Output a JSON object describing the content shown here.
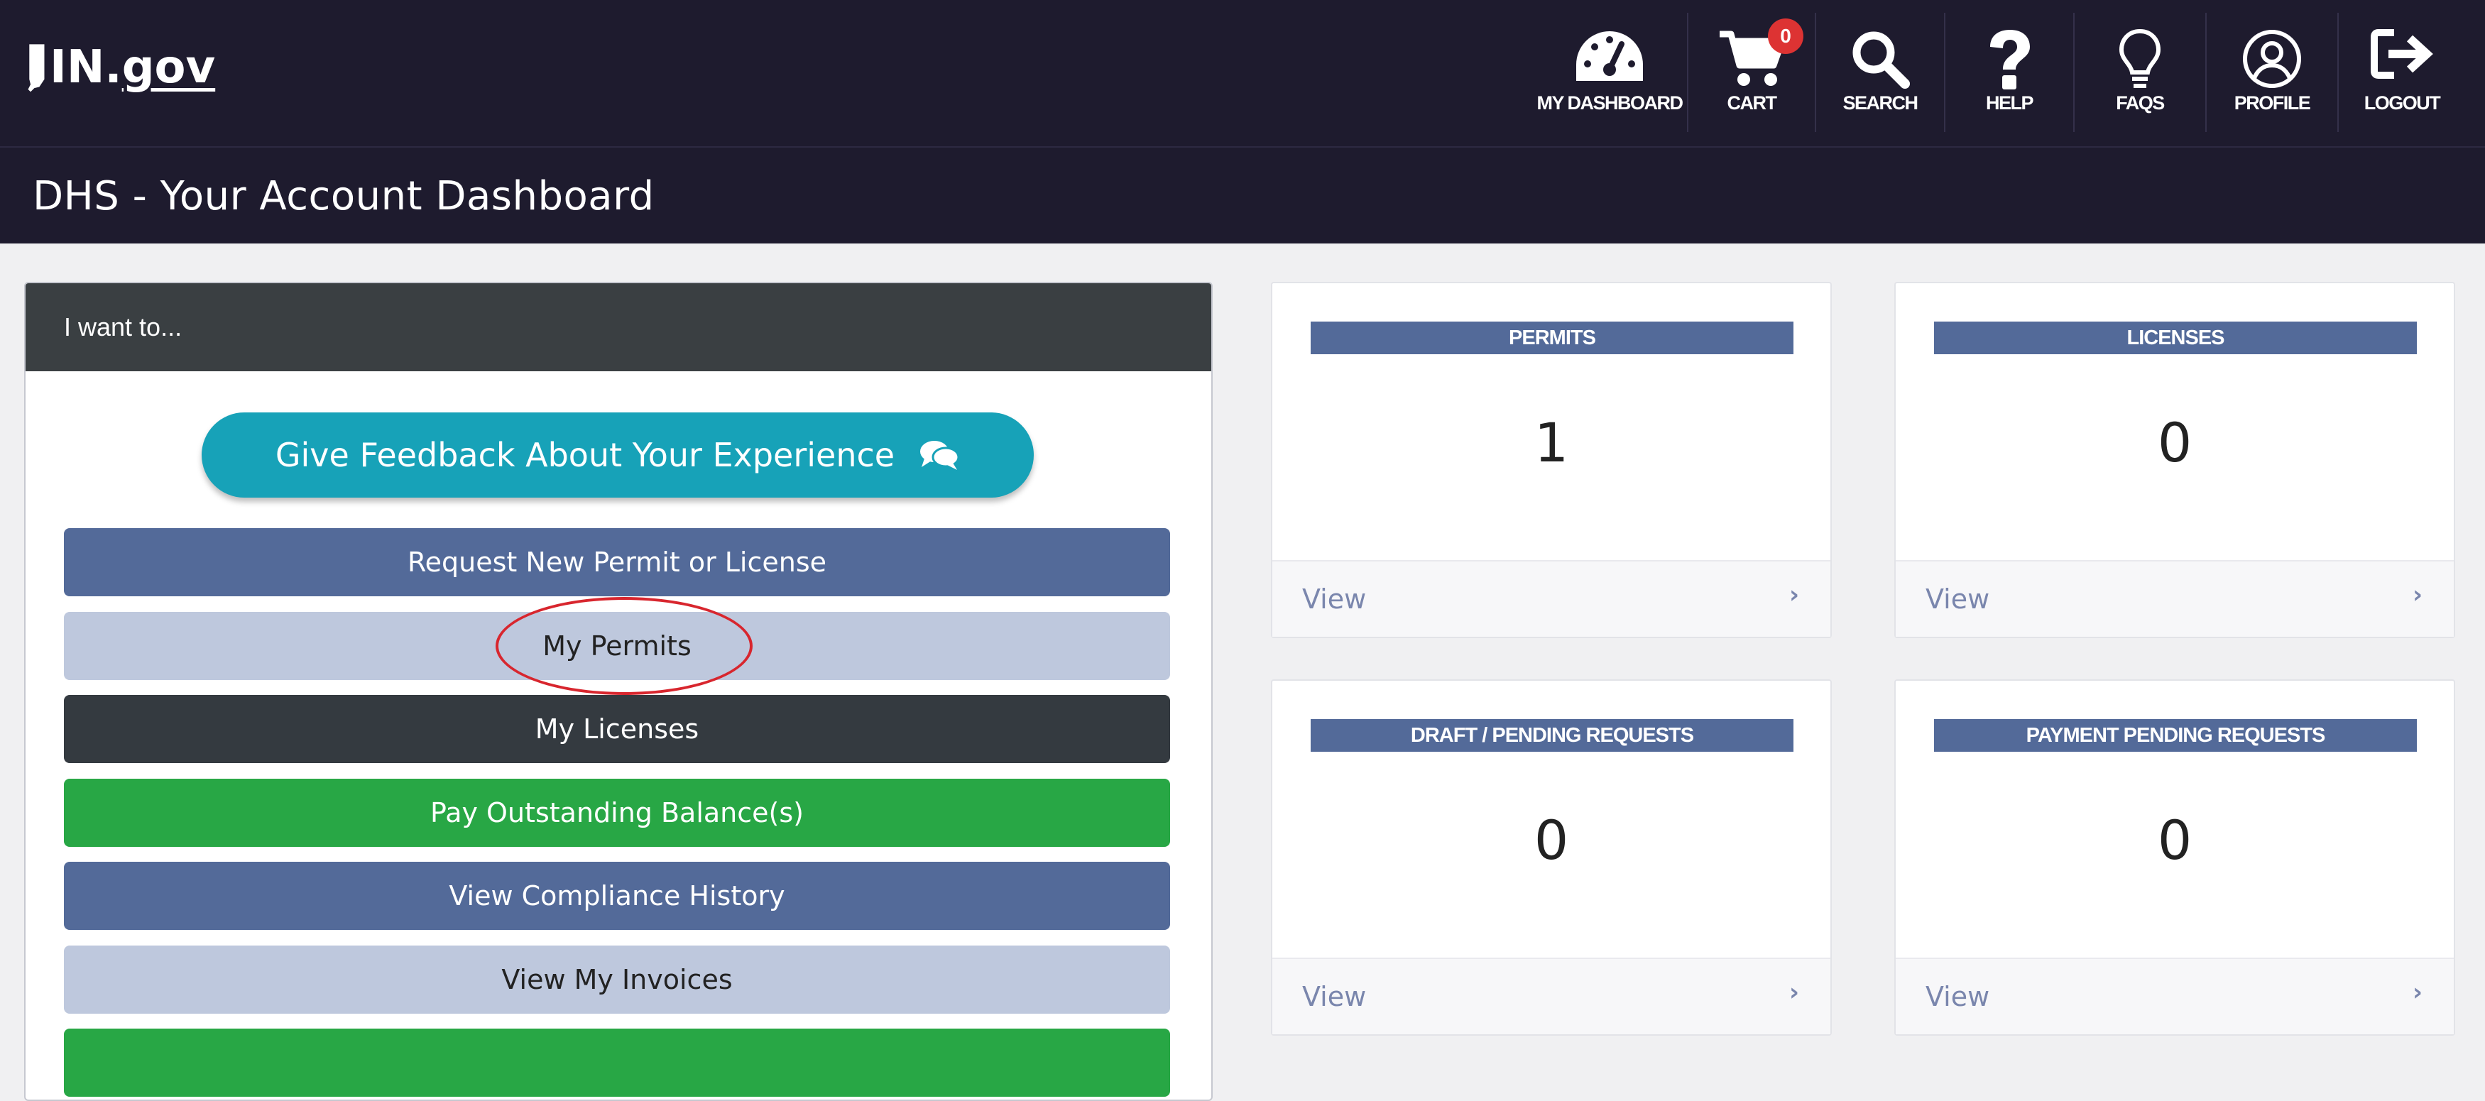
{
  "brand": {
    "logo_prefix": "IN.",
    "logo_suffix": "gov"
  },
  "nav": {
    "items": [
      {
        "label": "MY DASHBOARD",
        "icon": "dashboard-gauge-icon"
      },
      {
        "label": "CART",
        "icon": "cart-icon",
        "badge": "0"
      },
      {
        "label": "SEARCH",
        "icon": "search-icon"
      },
      {
        "label": "HELP",
        "icon": "question-icon"
      },
      {
        "label": "FAQS",
        "icon": "lightbulb-icon"
      },
      {
        "label": "PROFILE",
        "icon": "user-circle-icon"
      },
      {
        "label": "LOGOUT",
        "icon": "logout-icon"
      }
    ]
  },
  "page": {
    "title": "DHS - Your Account Dashboard"
  },
  "panel": {
    "heading": "I want to...",
    "feedback_label": "Give Feedback About Your Experience",
    "actions": [
      {
        "label": "Request New Permit or License"
      },
      {
        "label": "My Permits"
      },
      {
        "label": "My Licenses"
      },
      {
        "label": "Pay Outstanding Balance(s)"
      },
      {
        "label": "View Compliance History"
      },
      {
        "label": "View My Invoices"
      },
      {
        "label": ""
      }
    ]
  },
  "cards": [
    {
      "title": "PERMITS",
      "value": "1",
      "link": "View",
      "chevron": "›"
    },
    {
      "title": "LICENSES",
      "value": "0",
      "link": "View",
      "chevron": "›"
    },
    {
      "title": "DRAFT / PENDING REQUESTS",
      "value": "0",
      "link": "View",
      "chevron": "›"
    },
    {
      "title": "PAYMENT PENDING REQUESTS",
      "value": "0",
      "link": "View",
      "chevron": "›"
    }
  ],
  "colors": {
    "header_bg": "#1e1b2e",
    "panel_head": "#3a3f42",
    "feedback": "#17a2b8",
    "primary_blue": "#536a99",
    "light_blue": "#bec8dd",
    "dark": "#343a40",
    "green": "#28a745",
    "badge_red": "#dd3333",
    "highlight_circle": "#d8262e"
  }
}
